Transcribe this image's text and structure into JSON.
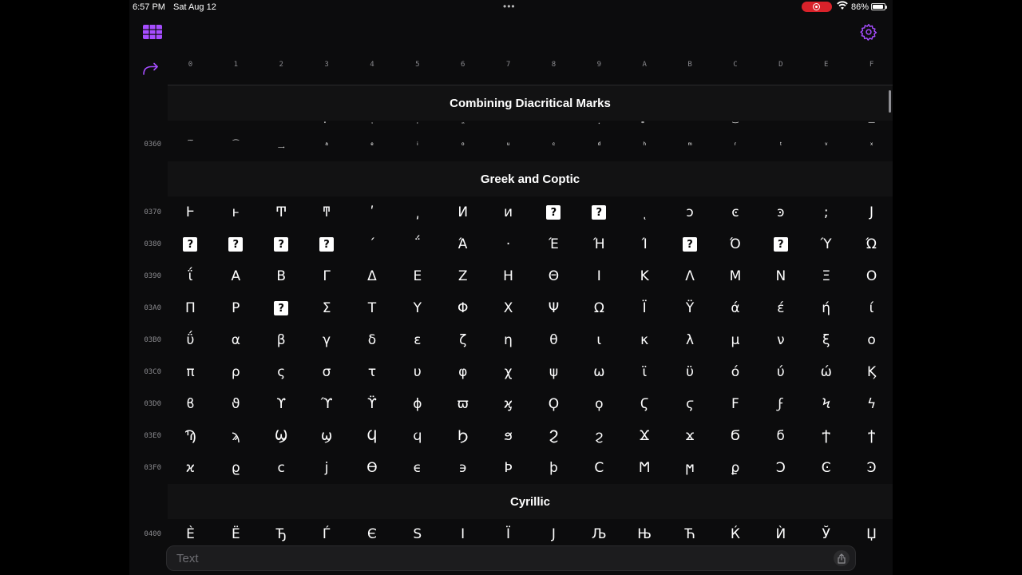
{
  "status_bar": {
    "time": "6:57 PM",
    "date": "Sat Aug 12",
    "battery": "86%",
    "recording_color": "#d9222a"
  },
  "toolbar": {
    "left_icon": "grid-icon",
    "right_icon": "gear-icon",
    "redo_icon": "redo-arrow-icon",
    "accent_color": "#a64dff"
  },
  "columns": [
    "0",
    "1",
    "2",
    "3",
    "4",
    "5",
    "6",
    "7",
    "8",
    "9",
    "A",
    "B",
    "C",
    "D",
    "E",
    "F"
  ],
  "sections": {
    "combining": "Combining Diacritical Marks",
    "greek": "Greek and Coptic",
    "cyrillic": "Cyrillic"
  },
  "rows": {
    "r0350": {
      "chars": [
        "",
        "",
        "",
        "͓",
        "͔",
        "͕",
        "͖",
        "͗",
        "͘",
        "͙",
        "͚",
        "͛",
        "͜",
        "",
        "",
        "͟"
      ]
    },
    "r0360": {
      "label": "0360",
      "chars": [
        "͠",
        "͡",
        "͢",
        "ͣ",
        "ͤ",
        "ͥ",
        "ͦ",
        "ͧ",
        "ͨ",
        "ͩ",
        "ͪ",
        "ͫ",
        "ͬ",
        "ͭ",
        "ͮ",
        "ͯ"
      ]
    },
    "r0370": {
      "label": "0370",
      "chars": [
        "Ͱ",
        "ͱ",
        "Ͳ",
        "ͳ",
        "ʹ",
        "͵",
        "Ͷ",
        "ͷ",
        "?",
        "?",
        "ͺ",
        "ͻ",
        "ͼ",
        "ͽ",
        ";",
        "Ϳ"
      ]
    },
    "r0380": {
      "label": "0380",
      "chars": [
        "?",
        "?",
        "?",
        "?",
        "΄",
        "΅",
        "Ά",
        "·",
        "Έ",
        "Ή",
        "Ί",
        "?",
        "Ό",
        "?",
        "Ύ",
        "Ώ"
      ]
    },
    "r0390": {
      "label": "0390",
      "chars": [
        "ΐ",
        "Α",
        "Β",
        "Γ",
        "Δ",
        "Ε",
        "Ζ",
        "Η",
        "Θ",
        "Ι",
        "Κ",
        "Λ",
        "Μ",
        "Ν",
        "Ξ",
        "Ο"
      ]
    },
    "r03A0": {
      "label": "03A0",
      "chars": [
        "Π",
        "Ρ",
        "?",
        "Σ",
        "Τ",
        "Υ",
        "Φ",
        "Χ",
        "Ψ",
        "Ω",
        "Ϊ",
        "Ϋ",
        "ά",
        "έ",
        "ή",
        "ί"
      ]
    },
    "r03B0": {
      "label": "03B0",
      "chars": [
        "ΰ",
        "α",
        "β",
        "γ",
        "δ",
        "ε",
        "ζ",
        "η",
        "θ",
        "ι",
        "κ",
        "λ",
        "μ",
        "ν",
        "ξ",
        "ο"
      ]
    },
    "r03C0": {
      "label": "03C0",
      "chars": [
        "π",
        "ρ",
        "ς",
        "σ",
        "τ",
        "υ",
        "φ",
        "χ",
        "ψ",
        "ω",
        "ϊ",
        "ϋ",
        "ό",
        "ύ",
        "ώ",
        "Ϗ"
      ]
    },
    "r03D0": {
      "label": "03D0",
      "chars": [
        "ϐ",
        "ϑ",
        "ϒ",
        "ϓ",
        "ϔ",
        "ϕ",
        "ϖ",
        "ϗ",
        "Ϙ",
        "ϙ",
        "Ϛ",
        "ϛ",
        "Ϝ",
        "ϝ",
        "Ϟ",
        "ϟ"
      ]
    },
    "r03E0": {
      "label": "03E0",
      "chars": [
        "Ϡ",
        "ϡ",
        "Ϣ",
        "ϣ",
        "Ϥ",
        "ϥ",
        "Ϧ",
        "ϧ",
        "Ϩ",
        "ϩ",
        "Ϫ",
        "ϫ",
        "Ϭ",
        "ϭ",
        "Ϯ",
        "ϯ"
      ]
    },
    "r03F0": {
      "label": "03F0",
      "chars": [
        "ϰ",
        "ϱ",
        "ϲ",
        "ϳ",
        "ϴ",
        "ϵ",
        "϶",
        "Ϸ",
        "ϸ",
        "Ϲ",
        "Ϻ",
        "ϻ",
        "ϼ",
        "Ͻ",
        "Ͼ",
        "Ͽ"
      ]
    },
    "r0400": {
      "label": "0400",
      "chars": [
        "Ѐ",
        "Ё",
        "Ђ",
        "Ѓ",
        "Є",
        "Ѕ",
        "І",
        "Ї",
        "Ј",
        "Љ",
        "Њ",
        "Ћ",
        "Ќ",
        "Ѝ",
        "Ў",
        "Џ"
      ]
    }
  },
  "input": {
    "placeholder": "Text",
    "share_icon": "share-icon"
  }
}
